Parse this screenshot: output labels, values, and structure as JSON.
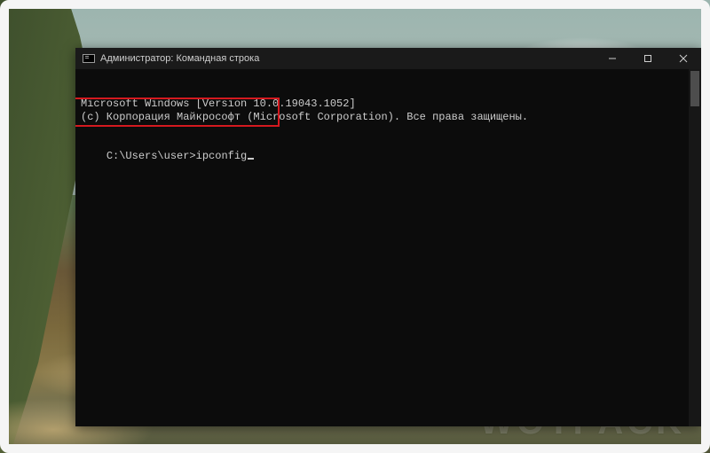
{
  "window": {
    "title": "Администратор: Командная строка"
  },
  "terminal": {
    "line1": "Microsoft Windows [Version 10.0.19043.1052]",
    "line2": "(c) Корпорация Майкрософт (Microsoft Corporation). Все права защищены.",
    "prompt": "C:\\Users\\user>",
    "command": "ipconfig"
  },
  "watermark": "WOTPACK"
}
